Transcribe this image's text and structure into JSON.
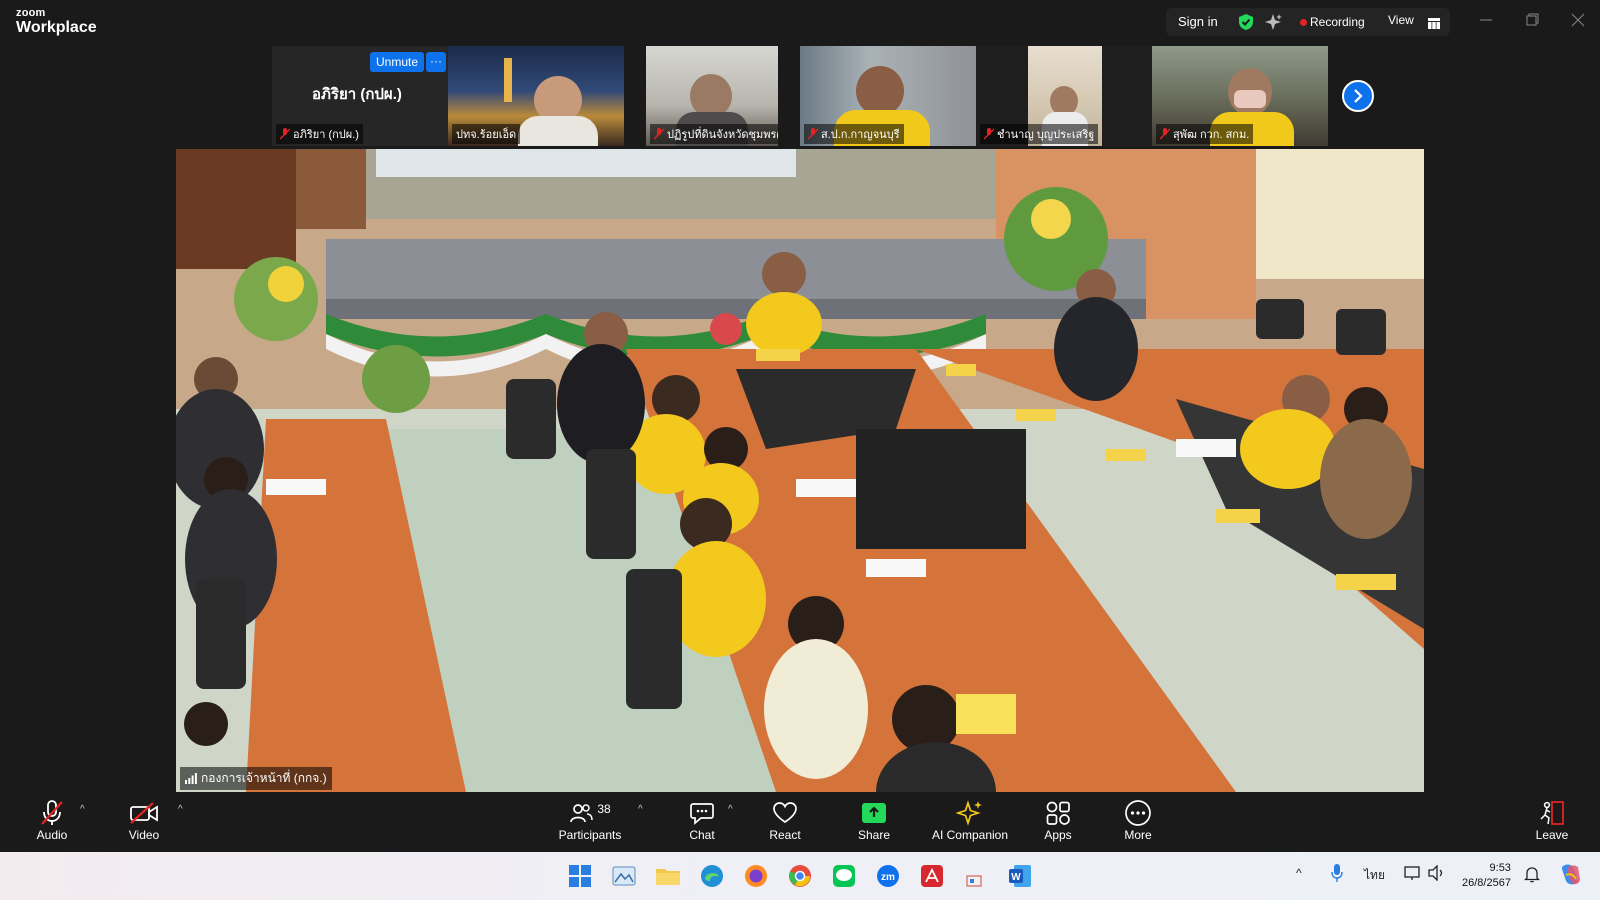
{
  "app": {
    "logo_top": "zoom",
    "logo_bottom": "Workplace"
  },
  "titlebar": {
    "sign_in": "Sign in",
    "recording": "Recording",
    "view": "View"
  },
  "self_tile": {
    "name_center": "อภิริยา (กปผ.)",
    "name_label": "อภิริยา (กปผ.)",
    "unmute": "Unmute",
    "more": "···"
  },
  "participants_tiles": [
    {
      "label": "ปทจ.ร้อยเอ็ด"
    },
    {
      "label": "ปฏิรูปที่ดินจังหวัดชุมพร(นาย..."
    },
    {
      "label": "ส.ป.ก.กาญจนบุรี"
    },
    {
      "label": "ชำนาญ บุญประเสริฐ"
    },
    {
      "label": "สุพัฒ กวก. สกม."
    }
  ],
  "main_video": {
    "label": "กองการเจ้าหน้าที่ (กกจ.)"
  },
  "toolbar": {
    "audio": "Audio",
    "video": "Video",
    "participants": "Participants",
    "participants_count": "38",
    "chat": "Chat",
    "react": "React",
    "share": "Share",
    "ai_companion": "AI Companion",
    "apps": "Apps",
    "more": "More",
    "leave": "Leave"
  },
  "taskbar": {
    "ime": "ไทย",
    "time": "9:53",
    "date": "26/8/2567"
  },
  "colors": {
    "accent": "#0e72ed",
    "share_green": "#23d959",
    "recording_red": "#e02424",
    "leave_red": "#e02424"
  }
}
